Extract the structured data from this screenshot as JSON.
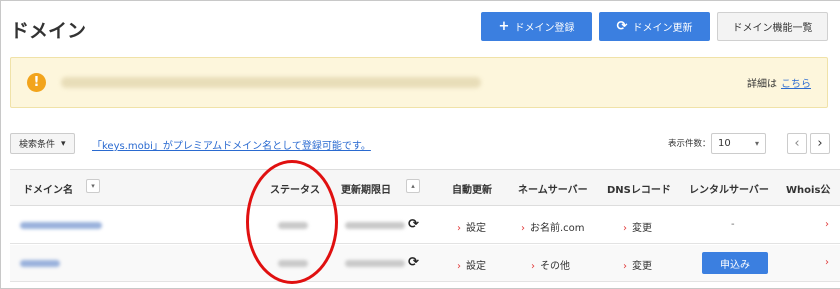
{
  "page": {
    "title": "ドメイン"
  },
  "toolbar": {
    "register_label": "ドメイン登録",
    "renew_label": "ドメイン更新",
    "list_label": "ドメイン機能一覧"
  },
  "notice": {
    "detail_label": "詳細は",
    "detail_link": "こちら"
  },
  "filters": {
    "search_condition": "検索条件",
    "promo_link": "「keys.mobi」がプレミアムドメイン名として登録可能です。",
    "count_label": "表示件数：",
    "count_value": "10"
  },
  "table": {
    "columns": [
      "ドメイン名",
      "ステータス",
      "更新期限日",
      "自動更新",
      "ネームサーバー",
      "DNSレコード",
      "レンタルサーバー",
      "Whois公"
    ],
    "rows": [
      {
        "auto_renew": "設定",
        "nameserver": "お名前.com",
        "dns": "変更",
        "rental": "-"
      },
      {
        "auto_renew": "設定",
        "nameserver": "その他",
        "dns": "変更",
        "rental": "申込み"
      }
    ]
  },
  "colors": {
    "accent": "#3b7fe0",
    "notice_bg": "#fdf6dc",
    "warning": "#f2a41c",
    "arrow": "#e23a3a",
    "highlight_circle": "#e01010"
  }
}
